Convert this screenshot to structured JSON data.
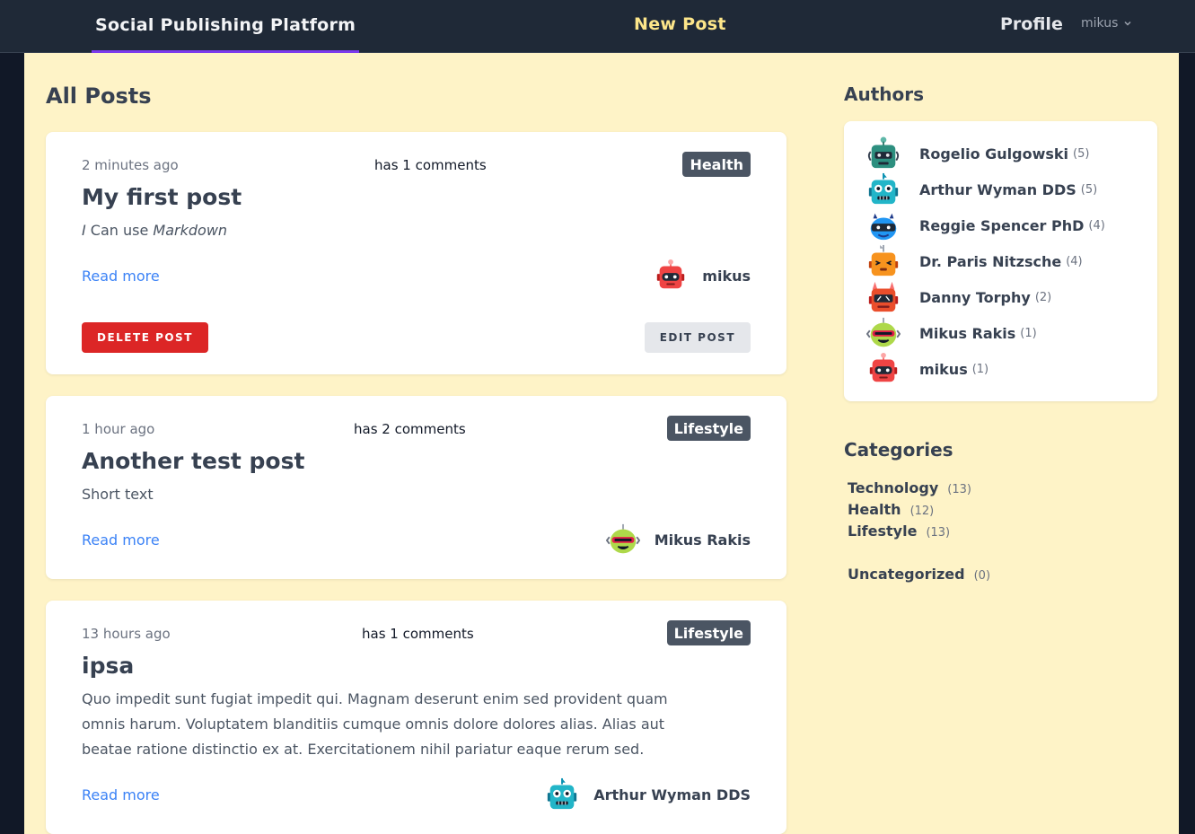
{
  "nav": {
    "brand": "Social Publishing Platform",
    "new_post": "New Post",
    "profile": "Profile",
    "user": "mikus"
  },
  "main": {
    "heading": "All Posts",
    "posts": [
      {
        "time": "2 minutes ago",
        "comments": "has 1 comments",
        "category": "Health",
        "title": "My first post",
        "excerpt_parts": [
          "I",
          " Can use ",
          "Markdown"
        ],
        "read_more": "Read more",
        "author": "mikus",
        "avatar": "red-robot-avatar",
        "delete_label": "DELETE POST",
        "edit_label": "EDIT POST"
      },
      {
        "time": "1 hour ago",
        "comments": "has 2 comments",
        "category": "Lifestyle",
        "title": "Another test post",
        "excerpt": "Short text",
        "read_more": "Read more",
        "author": "Mikus Rakis",
        "avatar": "lime-robot-avatar"
      },
      {
        "time": "13 hours ago",
        "comments": "has 1 comments",
        "category": "Lifestyle",
        "title": "ipsa",
        "excerpt_lines": [
          "Quo impedit sunt fugiat impedit qui. Magnam deserunt enim sed provident quam",
          "omnis harum. Voluptatem blanditiis cumque omnis dolore dolores alias. Alias aut",
          "beatae ratione distinctio ex at. Exercitationem nihil pariatur eaque rerum sed."
        ],
        "read_more": "Read more",
        "author": "Arthur Wyman DDS",
        "avatar": "teal-robot-avatar"
      }
    ]
  },
  "sidebar": {
    "authors_heading": "Authors",
    "authors": [
      {
        "name": "Rogelio Gulgowski",
        "count": "(5)",
        "avatar": "green-robot-avatar"
      },
      {
        "name": "Arthur Wyman DDS",
        "count": "(5)",
        "avatar": "teal-robot-avatar"
      },
      {
        "name": "Reggie Spencer PhD",
        "count": "(4)",
        "avatar": "blue-robot-avatar"
      },
      {
        "name": "Dr. Paris Nitzsche",
        "count": "(4)",
        "avatar": "orange-robot-avatar"
      },
      {
        "name": "Danny Torphy",
        "count": "(2)",
        "avatar": "red-orange-robot-avatar"
      },
      {
        "name": "Mikus Rakis",
        "count": "(1)",
        "avatar": "lime-robot-avatar"
      },
      {
        "name": "mikus",
        "count": "(1)",
        "avatar": "red-robot-avatar"
      }
    ],
    "categories_heading": "Categories",
    "categories": [
      {
        "name": "Technology",
        "count": "(13)"
      },
      {
        "name": "Health",
        "count": "(12)"
      },
      {
        "name": "Lifestyle",
        "count": "(13)"
      },
      {
        "name": "Uncategorized",
        "count": "(0)"
      }
    ]
  },
  "colors": {
    "nav_bg": "#1f2937",
    "page_bg": "#fef3c7",
    "accent": "#7c3aed",
    "new_post": "#fde68a",
    "link": "#3b82f6",
    "delete": "#dc2626",
    "badge": "#4b5563"
  }
}
